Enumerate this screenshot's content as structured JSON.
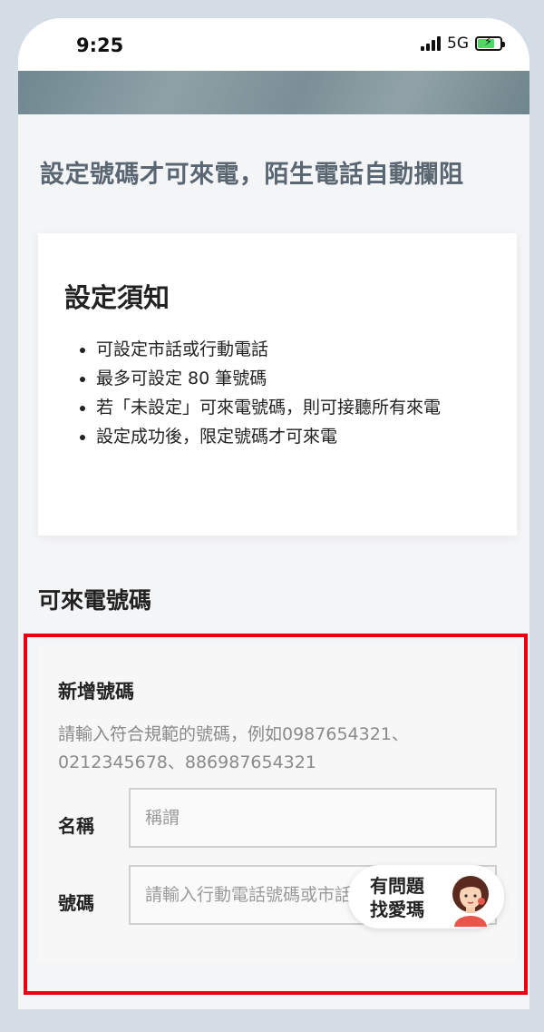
{
  "status_bar": {
    "time": "9:25",
    "network": "5G",
    "battery_color": "#4cd964"
  },
  "page": {
    "headline": "設定號碼才可來電，陌生電話自動攔阻"
  },
  "notice": {
    "title": "設定須知",
    "items": [
      "可設定市話或行動電話",
      "最多可設定 80 筆號碼",
      "若「未設定」可來電號碼，則可接聽所有來電",
      "設定成功後，限定號碼才可來電"
    ]
  },
  "allowed_numbers": {
    "section_title": "可來電號碼",
    "form": {
      "title": "新增號碼",
      "hint": "請輸入符合規範的號碼，例如0987654321、0212345678、886987654321",
      "name_label": "名稱",
      "name_placeholder": "稱謂",
      "number_label": "號碼",
      "number_placeholder": "請輸入行動電話號碼或市話"
    }
  },
  "help_button": {
    "line1": "有問題",
    "line2": "找愛瑪"
  },
  "colors": {
    "highlight": "#e60012",
    "headline": "#5a6672",
    "hint": "#8a8a8a"
  }
}
